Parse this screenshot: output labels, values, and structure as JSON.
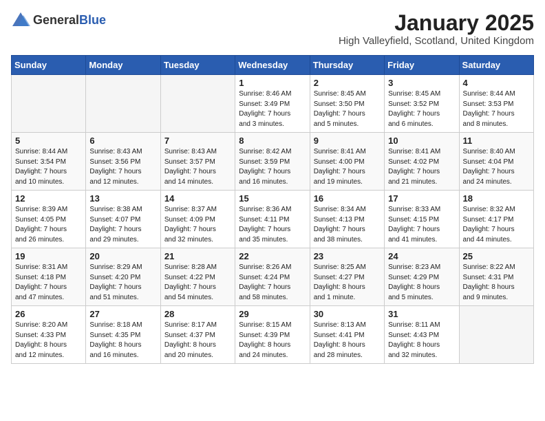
{
  "logo": {
    "general": "General",
    "blue": "Blue"
  },
  "header": {
    "month": "January 2025",
    "location": "High Valleyfield, Scotland, United Kingdom"
  },
  "weekdays": [
    "Sunday",
    "Monday",
    "Tuesday",
    "Wednesday",
    "Thursday",
    "Friday",
    "Saturday"
  ],
  "weeks": [
    [
      {
        "day": "",
        "info": ""
      },
      {
        "day": "",
        "info": ""
      },
      {
        "day": "",
        "info": ""
      },
      {
        "day": "1",
        "info": "Sunrise: 8:46 AM\nSunset: 3:49 PM\nDaylight: 7 hours\nand 3 minutes."
      },
      {
        "day": "2",
        "info": "Sunrise: 8:45 AM\nSunset: 3:50 PM\nDaylight: 7 hours\nand 5 minutes."
      },
      {
        "day": "3",
        "info": "Sunrise: 8:45 AM\nSunset: 3:52 PM\nDaylight: 7 hours\nand 6 minutes."
      },
      {
        "day": "4",
        "info": "Sunrise: 8:44 AM\nSunset: 3:53 PM\nDaylight: 7 hours\nand 8 minutes."
      }
    ],
    [
      {
        "day": "5",
        "info": "Sunrise: 8:44 AM\nSunset: 3:54 PM\nDaylight: 7 hours\nand 10 minutes."
      },
      {
        "day": "6",
        "info": "Sunrise: 8:43 AM\nSunset: 3:56 PM\nDaylight: 7 hours\nand 12 minutes."
      },
      {
        "day": "7",
        "info": "Sunrise: 8:43 AM\nSunset: 3:57 PM\nDaylight: 7 hours\nand 14 minutes."
      },
      {
        "day": "8",
        "info": "Sunrise: 8:42 AM\nSunset: 3:59 PM\nDaylight: 7 hours\nand 16 minutes."
      },
      {
        "day": "9",
        "info": "Sunrise: 8:41 AM\nSunset: 4:00 PM\nDaylight: 7 hours\nand 19 minutes."
      },
      {
        "day": "10",
        "info": "Sunrise: 8:41 AM\nSunset: 4:02 PM\nDaylight: 7 hours\nand 21 minutes."
      },
      {
        "day": "11",
        "info": "Sunrise: 8:40 AM\nSunset: 4:04 PM\nDaylight: 7 hours\nand 24 minutes."
      }
    ],
    [
      {
        "day": "12",
        "info": "Sunrise: 8:39 AM\nSunset: 4:05 PM\nDaylight: 7 hours\nand 26 minutes."
      },
      {
        "day": "13",
        "info": "Sunrise: 8:38 AM\nSunset: 4:07 PM\nDaylight: 7 hours\nand 29 minutes."
      },
      {
        "day": "14",
        "info": "Sunrise: 8:37 AM\nSunset: 4:09 PM\nDaylight: 7 hours\nand 32 minutes."
      },
      {
        "day": "15",
        "info": "Sunrise: 8:36 AM\nSunset: 4:11 PM\nDaylight: 7 hours\nand 35 minutes."
      },
      {
        "day": "16",
        "info": "Sunrise: 8:34 AM\nSunset: 4:13 PM\nDaylight: 7 hours\nand 38 minutes."
      },
      {
        "day": "17",
        "info": "Sunrise: 8:33 AM\nSunset: 4:15 PM\nDaylight: 7 hours\nand 41 minutes."
      },
      {
        "day": "18",
        "info": "Sunrise: 8:32 AM\nSunset: 4:17 PM\nDaylight: 7 hours\nand 44 minutes."
      }
    ],
    [
      {
        "day": "19",
        "info": "Sunrise: 8:31 AM\nSunset: 4:18 PM\nDaylight: 7 hours\nand 47 minutes."
      },
      {
        "day": "20",
        "info": "Sunrise: 8:29 AM\nSunset: 4:20 PM\nDaylight: 7 hours\nand 51 minutes."
      },
      {
        "day": "21",
        "info": "Sunrise: 8:28 AM\nSunset: 4:22 PM\nDaylight: 7 hours\nand 54 minutes."
      },
      {
        "day": "22",
        "info": "Sunrise: 8:26 AM\nSunset: 4:24 PM\nDaylight: 7 hours\nand 58 minutes."
      },
      {
        "day": "23",
        "info": "Sunrise: 8:25 AM\nSunset: 4:27 PM\nDaylight: 8 hours\nand 1 minute."
      },
      {
        "day": "24",
        "info": "Sunrise: 8:23 AM\nSunset: 4:29 PM\nDaylight: 8 hours\nand 5 minutes."
      },
      {
        "day": "25",
        "info": "Sunrise: 8:22 AM\nSunset: 4:31 PM\nDaylight: 8 hours\nand 9 minutes."
      }
    ],
    [
      {
        "day": "26",
        "info": "Sunrise: 8:20 AM\nSunset: 4:33 PM\nDaylight: 8 hours\nand 12 minutes."
      },
      {
        "day": "27",
        "info": "Sunrise: 8:18 AM\nSunset: 4:35 PM\nDaylight: 8 hours\nand 16 minutes."
      },
      {
        "day": "28",
        "info": "Sunrise: 8:17 AM\nSunset: 4:37 PM\nDaylight: 8 hours\nand 20 minutes."
      },
      {
        "day": "29",
        "info": "Sunrise: 8:15 AM\nSunset: 4:39 PM\nDaylight: 8 hours\nand 24 minutes."
      },
      {
        "day": "30",
        "info": "Sunrise: 8:13 AM\nSunset: 4:41 PM\nDaylight: 8 hours\nand 28 minutes."
      },
      {
        "day": "31",
        "info": "Sunrise: 8:11 AM\nSunset: 4:43 PM\nDaylight: 8 hours\nand 32 minutes."
      },
      {
        "day": "",
        "info": ""
      }
    ]
  ]
}
